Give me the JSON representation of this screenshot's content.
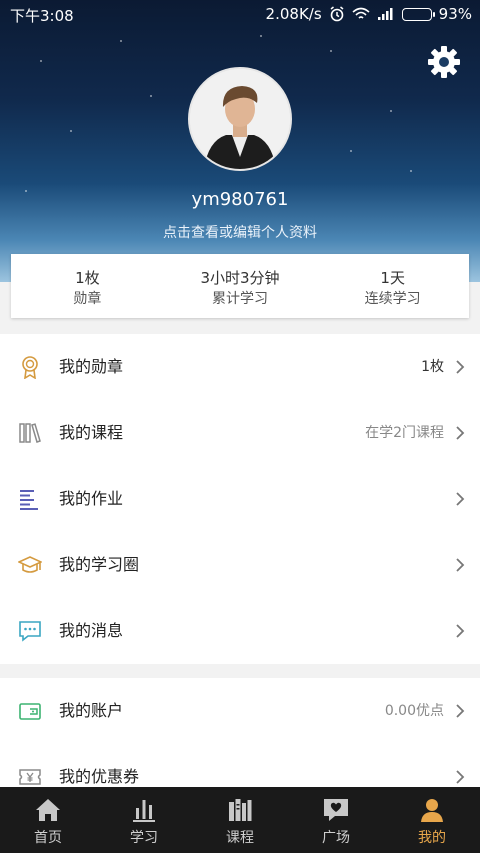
{
  "status_bar": {
    "time": "下午3:08",
    "speed": "2.08K/s",
    "battery_percent": "93%",
    "battery_level": 0.93
  },
  "profile": {
    "username": "ym980761",
    "edit_link": "点击查看或编辑个人资料"
  },
  "stats": [
    {
      "value": "1枚",
      "label": "勋章"
    },
    {
      "value": "3小时3分钟",
      "label": "累计学习"
    },
    {
      "value": "1天",
      "label": "连续学习"
    }
  ],
  "menu": [
    {
      "label": "我的勋章",
      "value": "1枚",
      "icon": "medal-icon"
    },
    {
      "label": "我的课程",
      "value": "在学2门课程",
      "icon": "books-icon"
    },
    {
      "label": "我的作业",
      "value": "",
      "icon": "homework-icon"
    },
    {
      "label": "我的学习圈",
      "value": "",
      "icon": "graduation-cap-icon"
    },
    {
      "label": "我的消息",
      "value": "",
      "icon": "message-icon"
    },
    {
      "label": "我的账户",
      "value": "0.00优点",
      "icon": "wallet-icon"
    },
    {
      "label": "我的优惠券",
      "value": "",
      "icon": "coupon-icon"
    }
  ],
  "tabs": [
    {
      "label": "首页",
      "icon": "home-icon"
    },
    {
      "label": "学习",
      "icon": "bar-chart-icon"
    },
    {
      "label": "课程",
      "icon": "library-icon"
    },
    {
      "label": "广场",
      "icon": "heart-chat-icon"
    },
    {
      "label": "我的",
      "icon": "person-icon",
      "active": true
    }
  ],
  "colors": {
    "accent": "#e7a64b",
    "tabbar_bg": "#1a1a1a",
    "header_top": "#0b1a33",
    "header_bottom": "#9cc4df"
  }
}
